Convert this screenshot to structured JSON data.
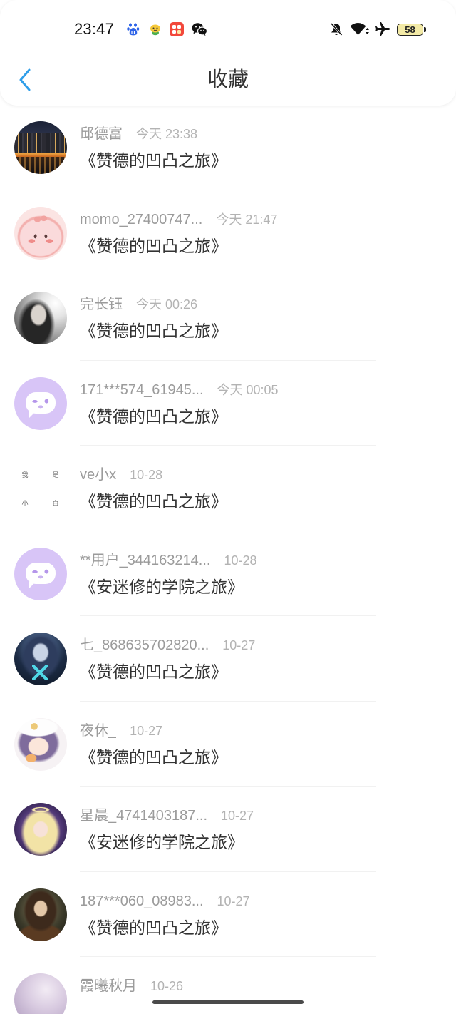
{
  "status_bar": {
    "time": "23:47",
    "left_icons": [
      "baidu-icon",
      "mascot-app-icon",
      "red-app-icon",
      "wechat-icon"
    ],
    "right_icons": [
      "mute-icon",
      "wifi-icon",
      "airplane-mode-icon"
    ],
    "battery": "58"
  },
  "header": {
    "back_icon": "chevron-left-icon",
    "title": "收藏"
  },
  "colors": {
    "accent": "#2f9ee9",
    "name_text": "#9b9b9b",
    "time_text": "#b3b3b3",
    "title_text": "#333333",
    "divider": "#f1f1f1"
  },
  "favorites": [
    {
      "avatar": "city-night-avatar",
      "name": "邱德富",
      "time": "今天 23:38",
      "title": "《赞德的凹凸之旅》"
    },
    {
      "avatar": "pink-character-avatar",
      "name": "momo_27400747...",
      "time": "今天 21:47",
      "title": "《赞德的凹凸之旅》"
    },
    {
      "avatar": "portrait-photo-avatar",
      "name": "完长钰",
      "time": "今天 00:26",
      "title": "《赞德的凹凸之旅》"
    },
    {
      "avatar": "chat-bubble-avatar",
      "name": "171***574_61945...",
      "time": "今天 00:05",
      "title": "《赞德的凹凸之旅》"
    },
    {
      "avatar": "text-avatar",
      "avatar_text": [
        "我",
        "是",
        "小",
        "白"
      ],
      "name": "ve小x",
      "time": "10-28",
      "title": "《赞德的凹凸之旅》"
    },
    {
      "avatar": "chat-bubble-avatar",
      "name": "**用户_344163214...",
      "time": "10-28",
      "title": "《安迷修的学院之旅》"
    },
    {
      "avatar": "anime-blue-avatar",
      "name": "七_868635702820...",
      "time": "10-27",
      "title": "《赞德的凹凸之旅》"
    },
    {
      "avatar": "anime-hat-avatar",
      "name": "夜休_",
      "time": "10-27",
      "title": "《赞德的凹凸之旅》"
    },
    {
      "avatar": "anime-halo-avatar",
      "name": "星晨_4741403187...",
      "time": "10-27",
      "title": "《安迷修的学院之旅》"
    },
    {
      "avatar": "anime-dark-avatar",
      "name": "187***060_08983...",
      "time": "10-27",
      "title": "《赞德的凹凸之旅》"
    },
    {
      "avatar": "lilac-photo-avatar",
      "name": "霞曦秋月",
      "time": "10-26"
    }
  ]
}
